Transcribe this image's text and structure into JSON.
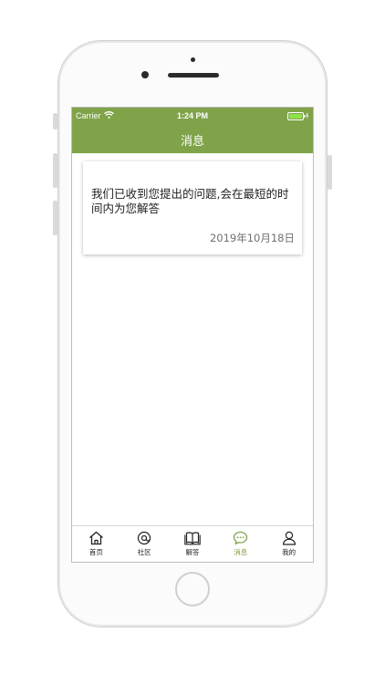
{
  "status_bar": {
    "carrier": "Carrier",
    "time": "1:24 PM"
  },
  "header": {
    "title": "消息"
  },
  "messages": [
    {
      "text": "我们已收到您提出的问题,会在最短的时间内为您解答",
      "date": "2019年10月18日"
    }
  ],
  "tabbar": {
    "items": [
      {
        "label": "首页",
        "icon": "home-icon"
      },
      {
        "label": "社区",
        "icon": "community-icon"
      },
      {
        "label": "解答",
        "icon": "book-icon"
      },
      {
        "label": "消息",
        "icon": "chat-icon"
      },
      {
        "label": "我的",
        "icon": "user-icon"
      }
    ],
    "active_index": 3
  },
  "colors": {
    "accent": "#80a34a",
    "battery": "#8ee34a"
  }
}
